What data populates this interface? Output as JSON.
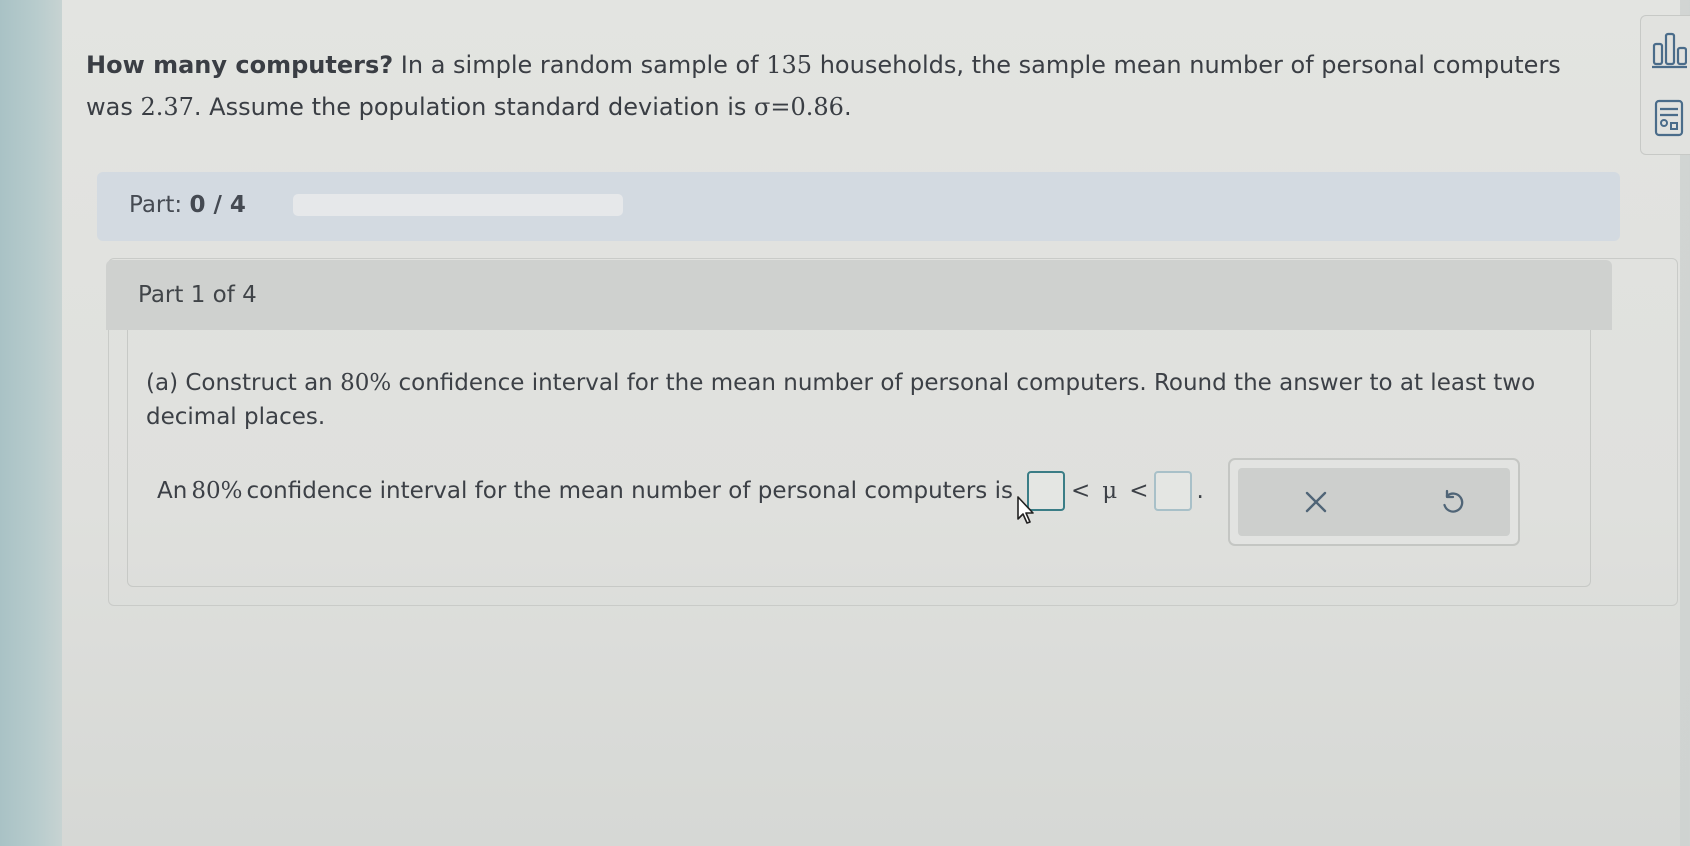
{
  "question": {
    "title_bold": "How many computers?",
    "text_part1": " In a simple random sample of ",
    "sample_size": "135",
    "text_part2": " households, the sample mean number of personal computers was ",
    "sample_mean": "2.37",
    "text_part3": ". Assume the population standard deviation is ",
    "sigma_expr": "σ=0.86",
    "text_end": "."
  },
  "progress": {
    "label": "Part:",
    "value_text": "0 / 4",
    "fraction": 0
  },
  "part": {
    "header": "Part 1 of 4",
    "instr_prefix": "(a) Construct an ",
    "instr_percent": "80%",
    "instr_suffix": " confidence interval for the mean number of personal computers. Round the answer to at least two decimal places.",
    "answer_prefix": "An ",
    "answer_percent": "80%",
    "answer_middle": " confidence interval for the mean number of personal computers is",
    "lt1": "<",
    "mu": "μ",
    "lt2": "<",
    "period": ".",
    "lower_value": "",
    "upper_value": ""
  },
  "actions": {
    "clear_icon": "close-x-icon",
    "undo_icon": "undo-arrow-icon"
  },
  "side_tools": {
    "icons": [
      "data-chart-icon",
      "calculator-icon"
    ]
  },
  "colors": {
    "progress_fill": "#2e7bb0",
    "input_focus": "#3a7d86",
    "input_idle": "#a8c0c8"
  }
}
